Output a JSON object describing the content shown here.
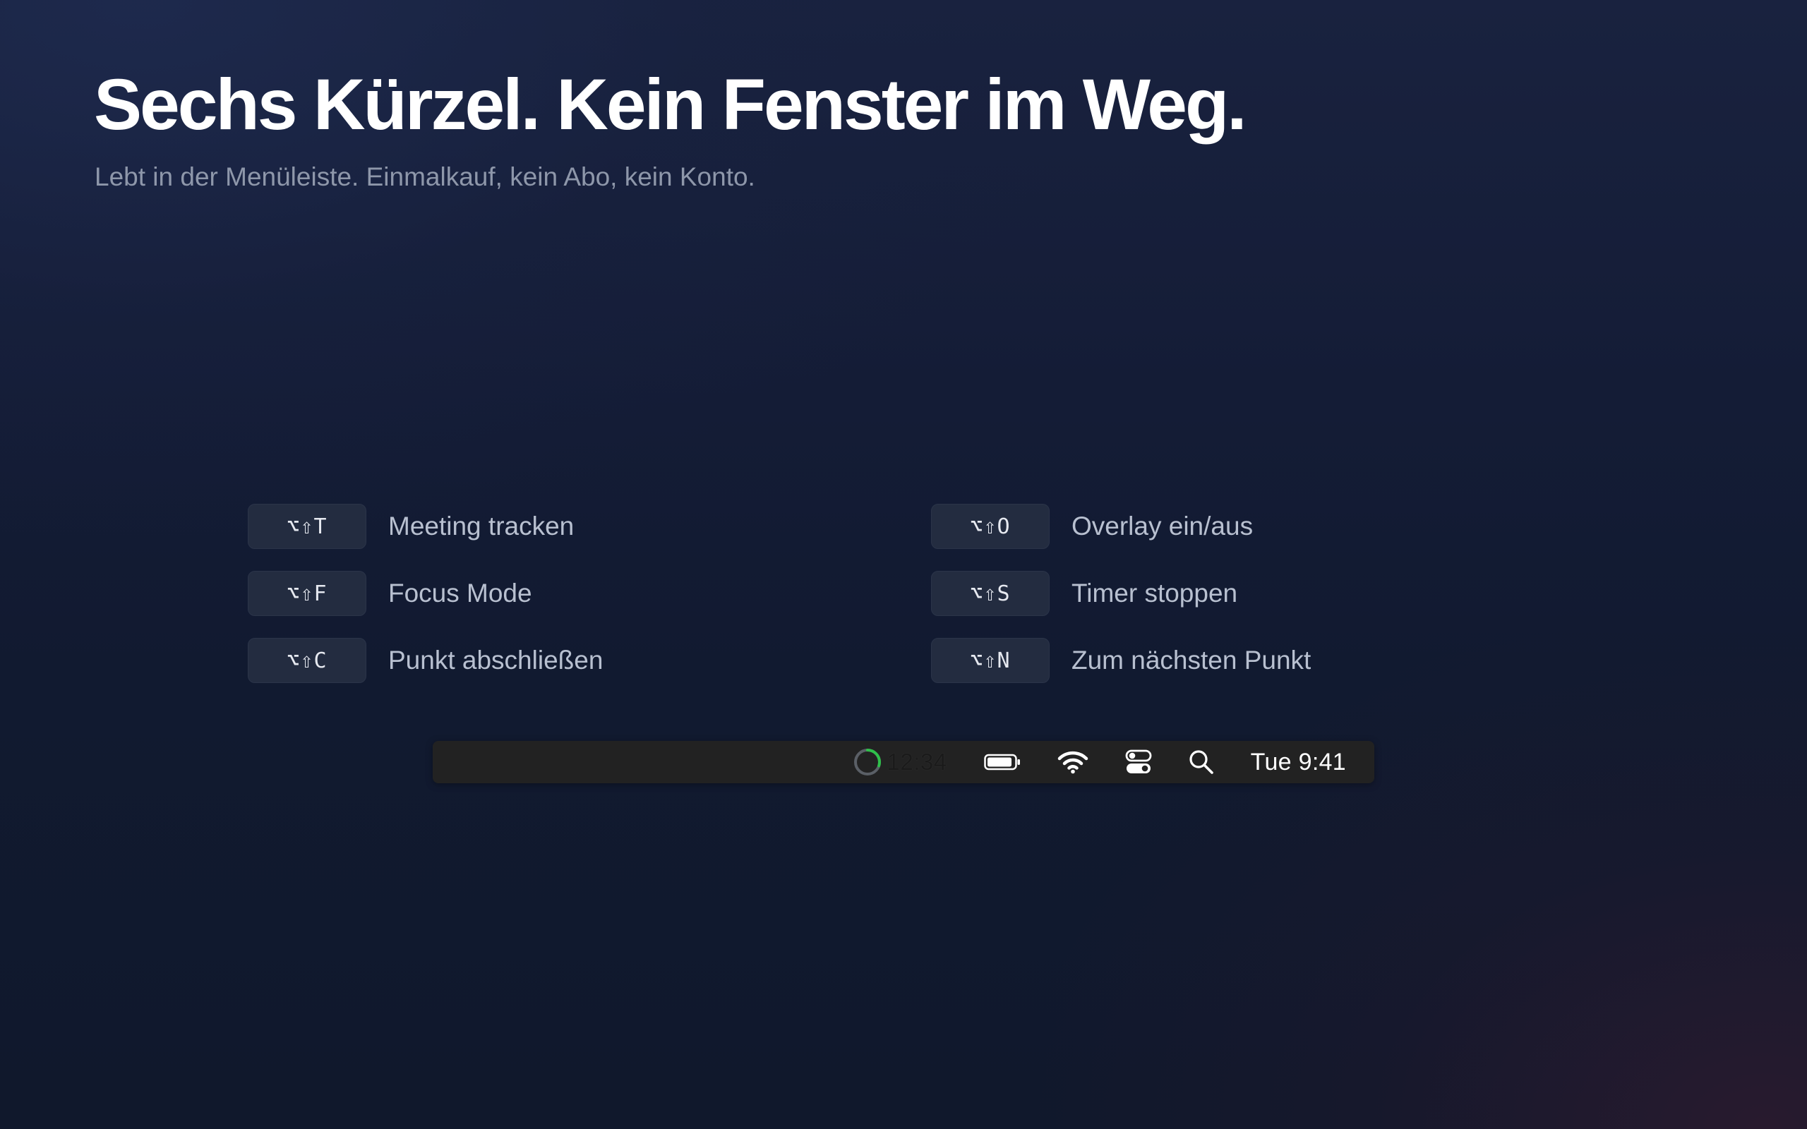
{
  "hero": {
    "title": "Sechs Kürzel. Kein Fenster im Weg.",
    "subtitle": "Lebt in der Menüleiste. Einmalkauf, kein Abo, kein Konto."
  },
  "shortcuts": [
    {
      "keys": "⌥⇧T",
      "label": "Meeting tracken"
    },
    {
      "keys": "⌥⇧F",
      "label": "Focus Mode"
    },
    {
      "keys": "⌥⇧C",
      "label": "Punkt abschließen"
    },
    {
      "keys": "⌥⇧O",
      "label": "Overlay ein/aus"
    },
    {
      "keys": "⌥⇧S",
      "label": "Timer stoppen"
    },
    {
      "keys": "⌥⇧N",
      "label": "Zum nächsten Punkt"
    }
  ],
  "menubar": {
    "timer": {
      "time": "12:34",
      "progress": 0.3,
      "ring_color": "#2fbf4a",
      "icon": "timer-ring-icon"
    },
    "icons": [
      "battery-icon",
      "wifi-icon",
      "control-center-icon",
      "search-icon"
    ],
    "clock": "Tue 9:41"
  },
  "colors": {
    "accent_green": "#2fbf4a",
    "keycap_bg": "#232c40",
    "menubar_bg": "#222222"
  }
}
